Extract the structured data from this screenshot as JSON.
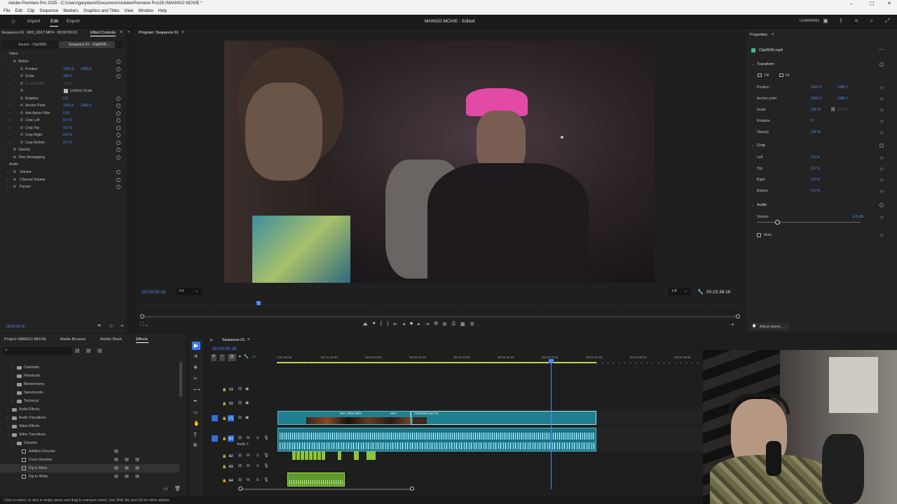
{
  "window": {
    "title": "Adobe Premiere Pro 2025 - C:\\Users\\garydavid\\Documents\\Adobe\\Premiere Pro\\25.0\\MANGO MOVIE *"
  },
  "menu": [
    "File",
    "Edit",
    "Clip",
    "Sequence",
    "Markers",
    "Graphics and Titles",
    "View",
    "Window",
    "Help"
  ],
  "header": {
    "home_icon": "home-icon",
    "tabs": [
      "Import",
      "Edit",
      "Export"
    ],
    "active_tab": "Edit",
    "project_title": "MANGO MOVIE - Edited",
    "workspace_label": "LEARNING"
  },
  "effect_controls": {
    "source_label": "Sequence 01 : MVI_0017.MP4 : 00:00:55:01",
    "panel_label": "Effect Controls",
    "subtab_source": "Source - Clip0005...",
    "subtab_seq": "Sequence 01 - Clip0005...",
    "section_video": "Video",
    "section_audio": "Audio",
    "rows": [
      {
        "name": "Motion",
        "value": "",
        "value2": ""
      },
      {
        "name": "Position",
        "value": "1920.0",
        "value2": "1080.0"
      },
      {
        "name": "Scale",
        "value": "100.0",
        "value2": ""
      },
      {
        "name": "Scale Width",
        "value": "100.0",
        "value2": ""
      },
      {
        "name": "Uniform Scale",
        "value": "",
        "value2": ""
      },
      {
        "name": "Rotation",
        "value": "0.0",
        "value2": ""
      },
      {
        "name": "Anchor Point",
        "value": "1920.0",
        "value2": "1080.0"
      },
      {
        "name": "Anti-flicker Filter",
        "value": "0.00",
        "value2": ""
      },
      {
        "name": "Crop Left",
        "value": "0.0 %",
        "value2": ""
      },
      {
        "name": "Crop Top",
        "value": "0.0 %",
        "value2": ""
      },
      {
        "name": "Crop Right",
        "value": "0.0 %",
        "value2": ""
      },
      {
        "name": "Crop Bottom",
        "value": "0.0 %",
        "value2": ""
      },
      {
        "name": "Opacity",
        "value": "",
        "value2": ""
      },
      {
        "name": "Time Remapping",
        "value": "",
        "value2": ""
      }
    ],
    "audio_rows": [
      "Volume",
      "Channel Volume",
      "Panner"
    ],
    "timecode": "00:03:00:16"
  },
  "program": {
    "title": "Program: Sequence 01",
    "timecode": "00:03:00:16",
    "fit": "Fit",
    "resolution": "1/8",
    "duration": "00:15:38:16"
  },
  "properties": {
    "title": "Properties",
    "clip_name": "Clip0005.mp4",
    "transform": "Transform",
    "fill": "Fill",
    "fit": "Fit",
    "position_label": "Position",
    "position_x": "1920 X",
    "position_y": "1080 Y",
    "anchor_label": "Anchor point",
    "anchor_x": "1920 X",
    "anchor_y": "1080 Y",
    "scale_label": "Scale",
    "scale_value": "100 %",
    "scale_value2": "100 %",
    "rotation_label": "Rotation",
    "rotation_value": "0 °",
    "opacity_label": "Opacity",
    "opacity_value": "100 %",
    "crop": "Crop",
    "crop_left": "Left",
    "crop_top": "Top",
    "crop_right": "Right",
    "crop_bottom": "Bottom",
    "crop_value": "0.0 %",
    "audio": "Audio",
    "volume_label": "Volume",
    "volume_value": "-6.9 dB",
    "volume_level": 0.2,
    "mute_label": "Mute",
    "adjust_speed": "Adjust speed..."
  },
  "project_panel": {
    "tabs": [
      "Project: MANGO MOVIE",
      "Media Browser",
      "Adobe Stock",
      "Effects"
    ],
    "active_tab": "Effects",
    "tree": [
      {
        "label": "Cinematic",
        "indent": 1,
        "folder": true
      },
      {
        "label": "Filmstocks",
        "indent": 1,
        "folder": true
      },
      {
        "label": "Monochrome",
        "indent": 1,
        "folder": true
      },
      {
        "label": "SpeedLooks",
        "indent": 1,
        "folder": true
      },
      {
        "label": "Technical",
        "indent": 1,
        "folder": true
      },
      {
        "label": "Audio Effects",
        "indent": 0,
        "folder": true
      },
      {
        "label": "Audio Transitions",
        "indent": 0,
        "folder": true
      },
      {
        "label": "Video Effects",
        "indent": 0,
        "folder": true
      },
      {
        "label": "Video Transitions",
        "indent": 0,
        "folder": true
      },
      {
        "label": "Dissolve",
        "indent": 1,
        "folder": true
      },
      {
        "label": "Additive Dissolve",
        "indent": 2,
        "folder": false
      },
      {
        "label": "Cross Dissolve",
        "indent": 2,
        "folder": false
      },
      {
        "label": "Dip to Black",
        "indent": 2,
        "folder": false
      },
      {
        "label": "Dip to White",
        "indent": 2,
        "folder": false
      }
    ]
  },
  "timeline": {
    "tab": "Sequence 01",
    "timecode": "00:03:00:16",
    "ruler": [
      "1:01:30:00",
      "00:01:45:00",
      "00:02:00:00",
      "00:02:15:00",
      "00:02:30:00",
      "00:02:45:00",
      "00:03:00:00",
      "00:03:15:00",
      "00:03:30:00",
      "00:03:45:00"
    ],
    "video_tracks": [
      "V3",
      "V2",
      "V1"
    ],
    "audio_tracks": [
      "A1",
      "A2",
      "A3",
      "A4"
    ],
    "audio1_name": "Audio 1",
    "clip_v1a": "MVI_0024.MP4",
    "clip_v1b": "MVI...",
    "clip_v1c": "Clip0005.mp4 [V]"
  },
  "status_bar": "Click to select, or click in empty space and drag to marquee select. Use Shift, Alt, and Ctrl for other options."
}
